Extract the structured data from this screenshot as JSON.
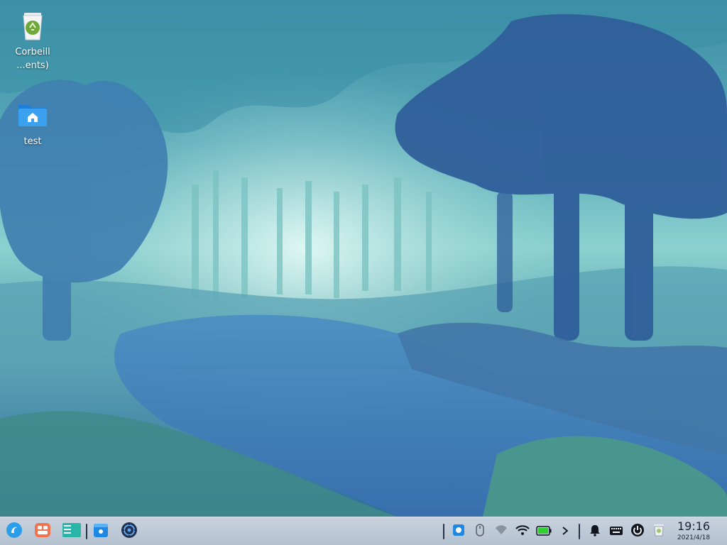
{
  "desktop": {
    "icons": [
      {
        "label": "Corbeill\n...ents)",
        "icon": "trash-icon"
      },
      {
        "label": "test",
        "icon": "home-folder-icon"
      }
    ]
  },
  "taskbar": {
    "launchers": [
      {
        "name": "launcher-icon"
      },
      {
        "name": "multitasking-view-icon"
      },
      {
        "name": "desktop-workspace-icon"
      },
      {
        "name": "app-store-icon"
      },
      {
        "name": "control-center-icon"
      }
    ],
    "tray": [
      {
        "name": "tray-app-icon"
      },
      {
        "name": "mouse-icon"
      },
      {
        "name": "network-icon"
      },
      {
        "name": "wifi-icon"
      },
      {
        "name": "battery-icon"
      },
      {
        "name": "chevron-right-icon"
      },
      {
        "name": "notification-bell-icon"
      },
      {
        "name": "keyboard-icon"
      },
      {
        "name": "power-icon"
      },
      {
        "name": "trash-icon"
      }
    ],
    "clock": {
      "time": "19:16",
      "date": "2021/4/18"
    }
  },
  "colors": {
    "taskbar": "#b4c1cf",
    "battery_green": "#2fd12f",
    "accent_blue": "#1e88e5"
  }
}
